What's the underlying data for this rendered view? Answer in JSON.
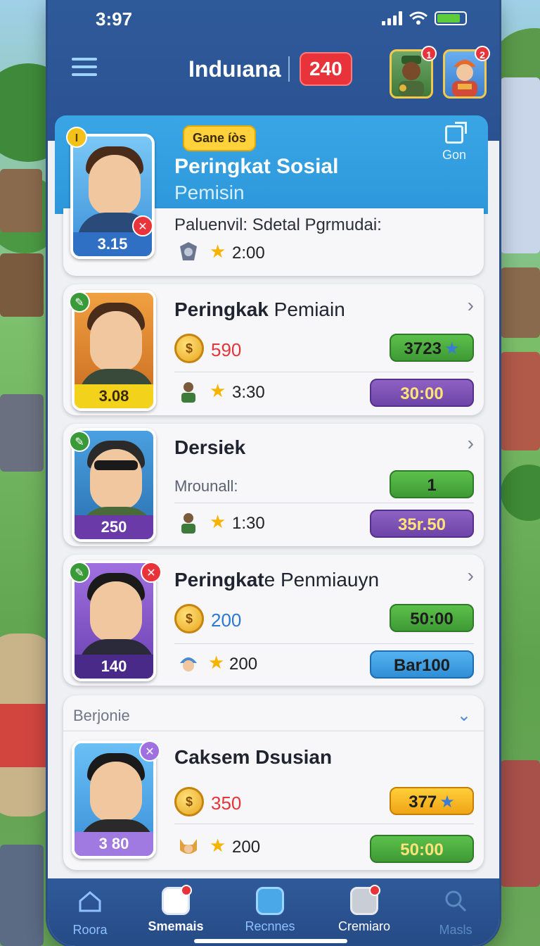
{
  "status": {
    "time": "3:97"
  },
  "header": {
    "app_title": "Induıana",
    "count_badge": "240",
    "avatar1_notif": "1",
    "avatar2_notif": "2"
  },
  "panel": {
    "chip": "Gane íòs",
    "title": "Peringkat Sosial",
    "subtitle": "Pemisin",
    "share_label": "Gon"
  },
  "cards": [
    {
      "portrait_num": "3.15",
      "badge_tl": "I",
      "line1": "Paluenvil: Sdetal Pgrmudai:",
      "star_value": "2:00"
    },
    {
      "portrait_num": "3.08",
      "title_bold": "Peringkak",
      "title_rest": " Pemiain",
      "coin_value": "590",
      "pill_top": "3723",
      "star_value": "3:30",
      "pill_bottom": "30:00"
    },
    {
      "portrait_num": "250",
      "title_bold": "Dersiek",
      "title_rest": "",
      "metric_label": "Mrounall:",
      "pill_top": "1",
      "star_value": "1:30",
      "pill_bottom": "35r.50"
    },
    {
      "portrait_num": "140",
      "title_bold": "Peringkat",
      "title_rest": "e Penmiauyn",
      "coin_value": "200",
      "pill_top": "50:00",
      "star_value": "200",
      "pill_bottom": "Bar100"
    },
    {
      "section_label": "Berjonie",
      "portrait_num": "3 80",
      "title_bold": "Caksem Dsusian",
      "title_rest": "",
      "coin_value": "350",
      "pill_top": "377",
      "star_value": "200",
      "pill_bottom": "50:00"
    }
  ],
  "nav": [
    {
      "label": "Roora",
      "icon": "home-icon"
    },
    {
      "label": "Smemais",
      "icon": "calendar-icon"
    },
    {
      "label": "Recnnes",
      "icon": "trophy-icon"
    },
    {
      "label": "Cremiaro",
      "icon": "check-icon"
    },
    {
      "label": "Masls",
      "icon": "search-icon"
    }
  ],
  "colors": {
    "accent_blue": "#2f5a9a",
    "panel_blue": "#3aa6e6",
    "badge_red": "#e8333a",
    "pill_green": "#5cc04b",
    "pill_purple": "#8e62c4"
  }
}
